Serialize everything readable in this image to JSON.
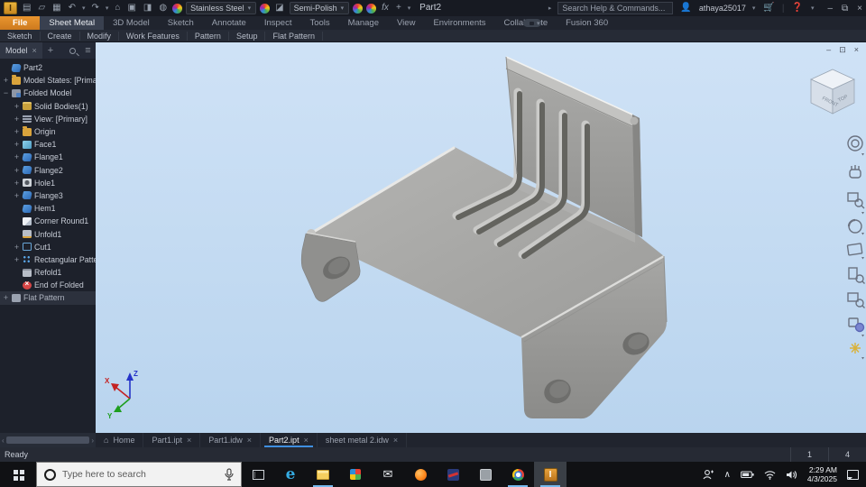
{
  "app": {
    "window_title": "Part2",
    "help_search_placeholder": "Search Help & Commands...",
    "user": "athaya25017",
    "material_selected": "Stainless Steel",
    "appearance_selected": "Semi-Polish",
    "fx_label": "fx"
  },
  "ribbon": {
    "tabs": [
      {
        "label": "File",
        "kind": "file"
      },
      {
        "label": "Sheet Metal",
        "kind": "active"
      },
      {
        "label": "3D Model",
        "kind": "normal"
      },
      {
        "label": "Sketch",
        "kind": "normal"
      },
      {
        "label": "Annotate",
        "kind": "normal"
      },
      {
        "label": "Inspect",
        "kind": "normal"
      },
      {
        "label": "Tools",
        "kind": "normal"
      },
      {
        "label": "Manage",
        "kind": "normal"
      },
      {
        "label": "View",
        "kind": "normal"
      },
      {
        "label": "Environments",
        "kind": "normal"
      },
      {
        "label": "Collaborate",
        "kind": "normal"
      },
      {
        "label": "Fusion 360",
        "kind": "normal"
      }
    ],
    "panels": [
      {
        "label": "Sketch"
      },
      {
        "label": "Create"
      },
      {
        "label": "Modify"
      },
      {
        "label": "Work Features"
      },
      {
        "label": "Pattern"
      },
      {
        "label": "Setup"
      },
      {
        "label": "Flat Pattern"
      }
    ]
  },
  "browser": {
    "tab_label": "Model",
    "items": [
      {
        "label": "Part2",
        "icon": "part",
        "exp": "",
        "ind": "0"
      },
      {
        "label": "Model States: [Primary]",
        "icon": "folder",
        "exp": "+",
        "ind": "0"
      },
      {
        "label": "Folded Model",
        "icon": "folded",
        "exp": "−",
        "ind": "0"
      },
      {
        "label": "Solid Bodies(1)",
        "icon": "solids",
        "exp": "+",
        "ind": "1"
      },
      {
        "label": "View: [Primary]",
        "icon": "view",
        "exp": "+",
        "ind": "1"
      },
      {
        "label": "Origin",
        "icon": "folder",
        "exp": "+",
        "ind": "1"
      },
      {
        "label": "Face1",
        "icon": "face",
        "exp": "+",
        "ind": "1"
      },
      {
        "label": "Flange1",
        "icon": "flange",
        "exp": "+",
        "ind": "1"
      },
      {
        "label": "Flange2",
        "icon": "flange",
        "exp": "+",
        "ind": "1"
      },
      {
        "label": "Hole1",
        "icon": "hole",
        "exp": "+",
        "ind": "1"
      },
      {
        "label": "Flange3",
        "icon": "flange",
        "exp": "+",
        "ind": "1"
      },
      {
        "label": "Hem1",
        "icon": "hem",
        "exp": "",
        "ind": "1"
      },
      {
        "label": "Corner Round1",
        "icon": "corner",
        "exp": "",
        "ind": "1"
      },
      {
        "label": "Unfold1",
        "icon": "unfold",
        "exp": "",
        "ind": "1"
      },
      {
        "label": "Cut1",
        "icon": "cut",
        "exp": "+",
        "ind": "1"
      },
      {
        "label": "Rectangular Pattern",
        "icon": "pattern",
        "exp": "+",
        "ind": "1"
      },
      {
        "label": "Refold1",
        "icon": "refold",
        "exp": "",
        "ind": "1"
      },
      {
        "label": "End of Folded",
        "icon": "end",
        "exp": "",
        "ind": "1"
      },
      {
        "label": "Flat Pattern",
        "icon": "flat",
        "exp": "+",
        "ind": "0"
      }
    ]
  },
  "viewport": {
    "viewcube": {
      "front": "FRONT",
      "top": "TOP"
    },
    "nav_tools": [
      "navigation-wheel",
      "pan",
      "zoom",
      "orbit",
      "look-at",
      "zoom-window",
      "zoom-selected",
      "visual-style",
      "lighting"
    ],
    "triad": {
      "x": "X",
      "y": "Y",
      "z": "Z"
    }
  },
  "doc_tabs": {
    "home_label": "Home",
    "items": [
      {
        "label": "Part1.ipt",
        "active": "false"
      },
      {
        "label": "Part1.idw",
        "active": "false"
      },
      {
        "label": "Part2.ipt",
        "active": "true"
      },
      {
        "label": "sheet metal 2.idw",
        "active": "false"
      }
    ]
  },
  "status": {
    "ready": "Ready",
    "counters": [
      "1",
      "4"
    ]
  },
  "taskbar": {
    "search_placeholder": "Type here to search",
    "apps": [
      {
        "icon": "taskview",
        "open": "false",
        "active": "false"
      },
      {
        "icon": "edge",
        "open": "false",
        "active": "false",
        "glyph": "e"
      },
      {
        "icon": "explorer",
        "open": "true",
        "active": "false"
      },
      {
        "icon": "store",
        "open": "false",
        "active": "false"
      },
      {
        "icon": "mail",
        "open": "false",
        "active": "false",
        "glyph": "✉"
      },
      {
        "icon": "firefox",
        "open": "false",
        "active": "false"
      },
      {
        "icon": "revo",
        "open": "false",
        "active": "false"
      },
      {
        "icon": "grayapp",
        "open": "false",
        "active": "false"
      },
      {
        "icon": "chrome",
        "open": "true",
        "active": "false"
      },
      {
        "icon": "inventor",
        "open": "true",
        "active": "true",
        "glyph": "I"
      }
    ],
    "clock": {
      "time": "2:29 AM",
      "date": "4/3/2025"
    }
  },
  "colors": {
    "accent_blue": "#3f8fe0",
    "ribbon_file_orange": "#e9952f",
    "viewport_top": "#cfe2f6",
    "viewport_bottom": "#b9d4ee",
    "metal_gray": "#a3a3a1",
    "taskbar_black": "#101114"
  }
}
